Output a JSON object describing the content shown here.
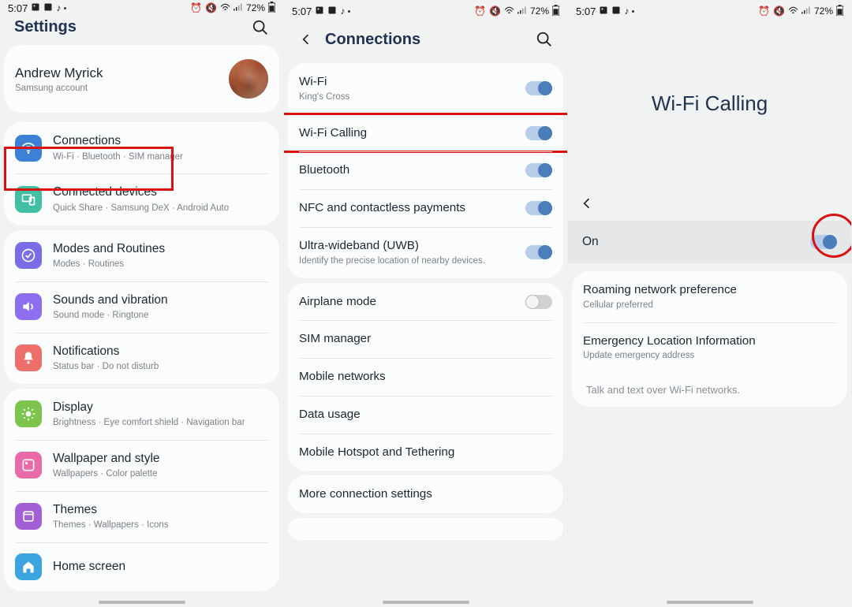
{
  "status": {
    "time": "5:07",
    "battery": "72%"
  },
  "screen1": {
    "title": "Settings",
    "profile": {
      "name": "Andrew Myrick",
      "sub": "Samsung account"
    },
    "groups": [
      {
        "items": [
          {
            "icon": "wifi",
            "bg": "bg-blue",
            "title": "Connections",
            "sub": "Wi-Fi  ·  Bluetooth  ·  SIM manager"
          },
          {
            "icon": "devices",
            "bg": "bg-teal",
            "title": "Connected devices",
            "sub": "Quick Share  ·  Samsung DeX  ·  Android Auto"
          }
        ]
      },
      {
        "items": [
          {
            "icon": "check",
            "bg": "bg-purple",
            "title": "Modes and Routines",
            "sub": "Modes  ·  Routines"
          },
          {
            "icon": "sound",
            "bg": "bg-violet",
            "title": "Sounds and vibration",
            "sub": "Sound mode  ·  Ringtone"
          },
          {
            "icon": "bell",
            "bg": "bg-coral",
            "title": "Notifications",
            "sub": "Status bar  ·  Do not disturb"
          }
        ]
      },
      {
        "items": [
          {
            "icon": "sun",
            "bg": "bg-green",
            "title": "Display",
            "sub": "Brightness  ·  Eye comfort shield  ·  Navigation bar"
          },
          {
            "icon": "palette",
            "bg": "bg-pink",
            "title": "Wallpaper and style",
            "sub": "Wallpapers  ·  Color palette"
          },
          {
            "icon": "themes",
            "bg": "bg-plum",
            "title": "Themes",
            "sub": "Themes  ·  Wallpapers  ·  Icons"
          },
          {
            "icon": "home",
            "bg": "bg-sky",
            "title": "Home screen",
            "sub": ""
          }
        ]
      }
    ]
  },
  "screen2": {
    "title": "Connections",
    "groups": [
      {
        "items": [
          {
            "title": "Wi-Fi",
            "sub": "King's Cross",
            "toggle": "on"
          },
          {
            "title": "Wi-Fi Calling",
            "toggle": "on",
            "hl": true
          },
          {
            "title": "Bluetooth",
            "toggle": "on"
          },
          {
            "title": "NFC and contactless payments",
            "toggle": "on"
          },
          {
            "title": "Ultra-wideband (UWB)",
            "sub": "Identify the precise location of nearby devices.",
            "toggle": "on"
          }
        ]
      },
      {
        "items": [
          {
            "title": "Airplane mode",
            "toggle": "off"
          },
          {
            "title": "SIM manager"
          },
          {
            "title": "Mobile networks"
          },
          {
            "title": "Data usage"
          },
          {
            "title": "Mobile Hotspot and Tethering"
          }
        ]
      },
      {
        "items": [
          {
            "title": "More connection settings"
          }
        ]
      },
      {
        "items": [
          {
            "title": ""
          }
        ]
      }
    ]
  },
  "screen3": {
    "hero": "Wi-Fi Calling",
    "onlabel": "On",
    "items": [
      {
        "title": "Roaming network preference",
        "sub": "Cellular preferred"
      },
      {
        "title": "Emergency Location Information",
        "sub": "Update emergency address"
      }
    ],
    "foot": "Talk and text over Wi-Fi networks."
  }
}
